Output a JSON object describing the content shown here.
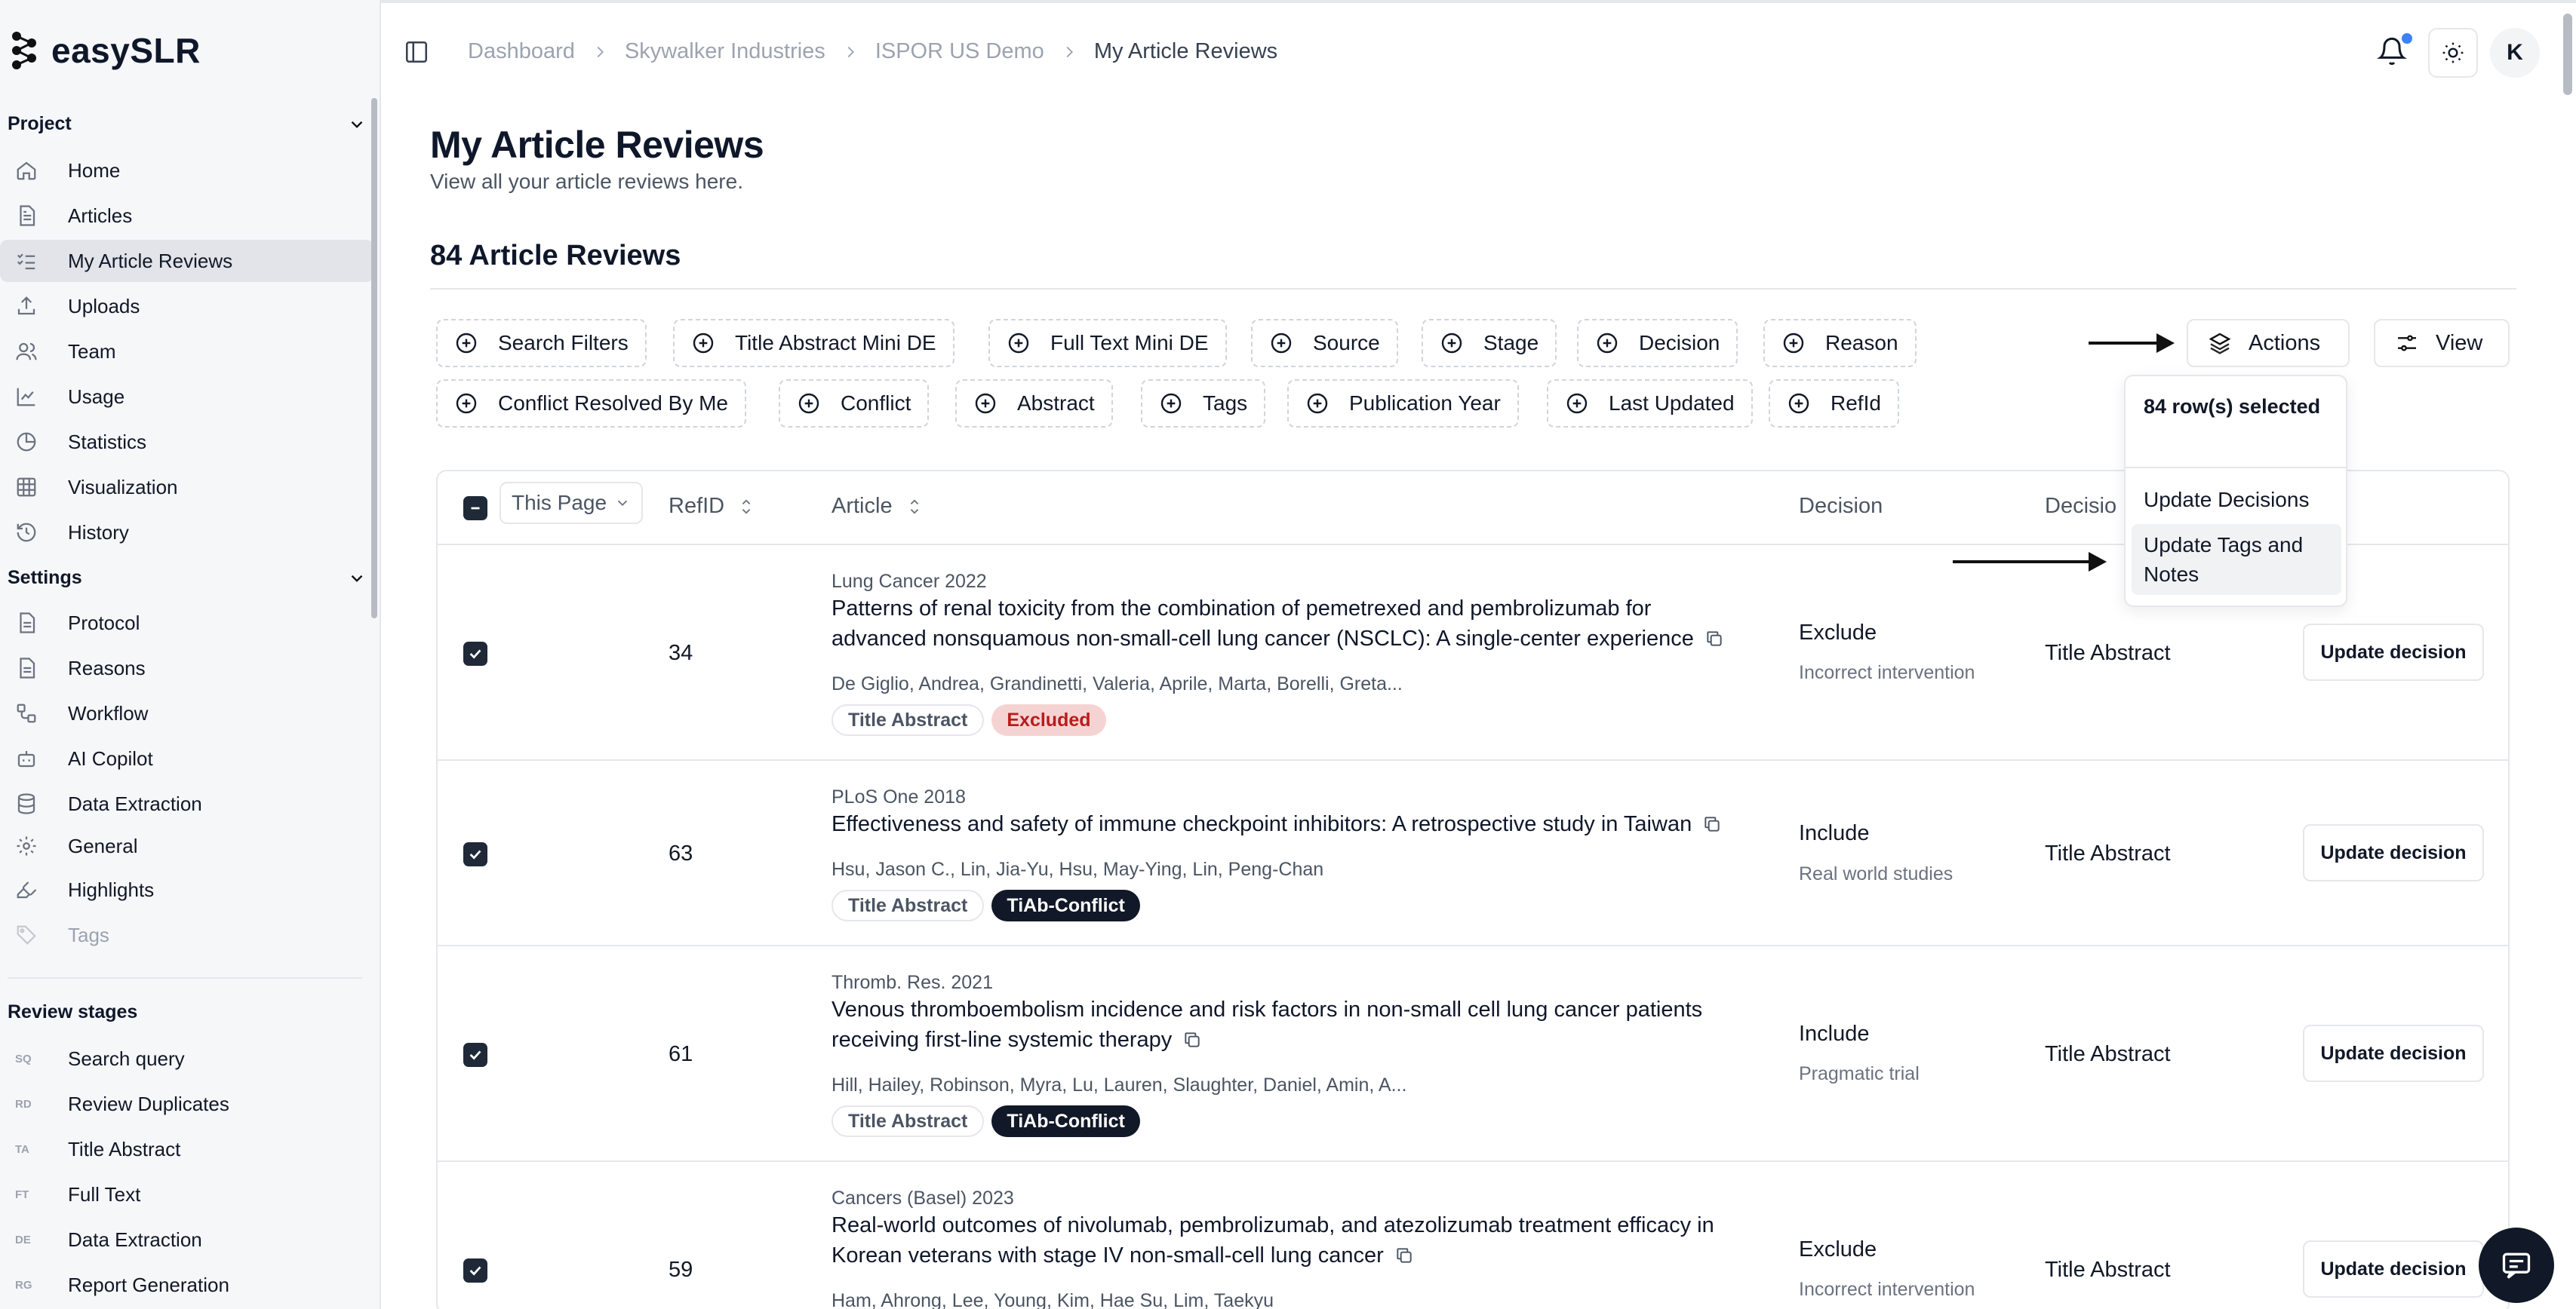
{
  "app": {
    "name": "easySLR"
  },
  "sidebar": {
    "project_header": "Project",
    "project_items": [
      {
        "label": "Home",
        "icon": "home-icon"
      },
      {
        "label": "Articles",
        "icon": "file-text-icon"
      },
      {
        "label": "My Article Reviews",
        "icon": "list-check-icon",
        "active": true
      },
      {
        "label": "Uploads",
        "icon": "upload-icon"
      },
      {
        "label": "Team",
        "icon": "users-icon"
      },
      {
        "label": "Usage",
        "icon": "line-chart-icon"
      },
      {
        "label": "Statistics",
        "icon": "pie-chart-icon"
      },
      {
        "label": "Visualization",
        "icon": "grid-icon"
      },
      {
        "label": "History",
        "icon": "history-icon"
      }
    ],
    "settings_header": "Settings",
    "settings_items": [
      {
        "label": "Protocol",
        "icon": "file-text-icon"
      },
      {
        "label": "Reasons",
        "icon": "file-text-icon"
      },
      {
        "label": "Workflow",
        "icon": "workflow-icon"
      },
      {
        "label": "AI Copilot",
        "icon": "bot-icon"
      },
      {
        "label": "Data Extraction",
        "icon": "database-icon"
      },
      {
        "label": "General",
        "icon": "gear-icon"
      },
      {
        "label": "Highlights",
        "icon": "highlighter-icon"
      },
      {
        "label": "Tags",
        "icon": "tag-icon"
      }
    ],
    "review_stages_header": "Review stages",
    "review_stages": [
      {
        "code": "SQ",
        "label": "Search query"
      },
      {
        "code": "RD",
        "label": "Review Duplicates"
      },
      {
        "code": "TA",
        "label": "Title Abstract"
      },
      {
        "code": "FT",
        "label": "Full Text"
      },
      {
        "code": "DE",
        "label": "Data Extraction"
      },
      {
        "code": "RG",
        "label": "Report Generation"
      }
    ]
  },
  "breadcrumb": [
    "Dashboard",
    "Skywalker Industries",
    "ISPOR US Demo",
    "My Article Reviews"
  ],
  "user": {
    "initial": "K"
  },
  "page": {
    "title": "My Article Reviews",
    "subtitle": "View all your article reviews here.",
    "count_title": "84 Article Reviews"
  },
  "filters": {
    "row1": [
      "Search Filters",
      "Title Abstract Mini DE",
      "Full Text Mini DE",
      "Source",
      "Stage",
      "Decision",
      "Reason"
    ],
    "row2": [
      "Conflict Resolved By Me",
      "Conflict",
      "Abstract",
      "Tags",
      "Publication Year",
      "Last Updated",
      "RefId"
    ]
  },
  "toolbar": {
    "actions_label": "Actions",
    "view_label": "View"
  },
  "actions_menu": {
    "selected_text": "84 row(s) selected",
    "items": [
      "Update Decisions",
      "Update Tags and Notes"
    ]
  },
  "table": {
    "page_selector": "This Page",
    "headers": {
      "refid": "RefID",
      "article": "Article",
      "decision": "Decision",
      "decision_stage": "Decisio"
    },
    "update_label": "Update decision",
    "rows": [
      {
        "refid": "34",
        "journal": "Lung Cancer 2022",
        "title": "Patterns of renal toxicity from the combination of pemetrexed and pembrolizumab for advanced nonsquamous non-small-cell lung cancer (NSCLC): A single-center experience",
        "authors": "De Giglio, Andrea, Grandinetti, Valeria, Aprile, Marta, Borelli, Greta...",
        "tags": [
          {
            "label": "Title Abstract",
            "style": "outline"
          },
          {
            "label": "Excluded",
            "style": "excluded"
          }
        ],
        "decision": "Exclude",
        "reason": "Incorrect intervention",
        "stage": "Title Abstract"
      },
      {
        "refid": "63",
        "journal": "PLoS One 2018",
        "title": "Effectiveness and safety of immune checkpoint inhibitors: A retrospective study in Taiwan",
        "authors": "Hsu, Jason C., Lin, Jia-Yu, Hsu, May-Ying, Lin, Peng-Chan",
        "tags": [
          {
            "label": "Title Abstract",
            "style": "outline"
          },
          {
            "label": "TiAb-Conflict",
            "style": "conflict"
          }
        ],
        "decision": "Include",
        "reason": "Real world studies",
        "stage": "Title Abstract"
      },
      {
        "refid": "61",
        "journal": "Thromb. Res. 2021",
        "title": "Venous thromboembolism incidence and risk factors in non-small cell lung cancer patients receiving first-line systemic therapy",
        "authors": "Hill, Hailey, Robinson, Myra, Lu, Lauren, Slaughter, Daniel, Amin, A...",
        "tags": [
          {
            "label": "Title Abstract",
            "style": "outline"
          },
          {
            "label": "TiAb-Conflict",
            "style": "conflict"
          }
        ],
        "decision": "Include",
        "reason": "Pragmatic trial",
        "stage": "Title Abstract"
      },
      {
        "refid": "59",
        "journal": "Cancers (Basel) 2023",
        "title": "Real-world outcomes of nivolumab, pembrolizumab, and atezolizumab treatment efficacy in Korean veterans with stage IV non-small-cell lung cancer",
        "authors": "Ham, Ahrong, Lee, Young, Kim, Hae Su, Lim, Taekyu",
        "tags": [],
        "decision": "Exclude",
        "reason": "Incorrect intervention",
        "stage": "Title Abstract"
      }
    ]
  }
}
